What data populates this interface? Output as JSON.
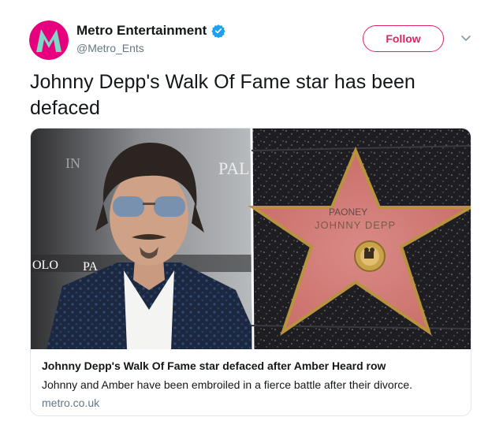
{
  "account": {
    "display_name": "Metro Entertainment",
    "handle": "@Metro_Ents",
    "follow_label": "Follow",
    "avatar_colors": [
      "#e6007e",
      "#7dd8c6"
    ]
  },
  "icons": {
    "verified": "verified-badge-icon",
    "more": "chevron-down-icon"
  },
  "tweet": {
    "text": "Johnny Depp's Walk Of Fame star has been defaced"
  },
  "card": {
    "image_text": {
      "star_name": "JOHNNY DEPP",
      "graffiti_top": "PAONEY",
      "backdrop_fragments": [
        "IN",
        "PAL",
        "OLO",
        "PA"
      ]
    },
    "title": "Johnny Depp's Walk Of Fame star defaced after Amber Heard row",
    "description": "Johnny and Amber have been embroiled in a fierce battle after their divorce.",
    "domain": "metro.co.uk"
  },
  "colors": {
    "follow_accent": "#e0245e",
    "verified_blue": "#1da1f2",
    "secondary_text": "#657786"
  }
}
